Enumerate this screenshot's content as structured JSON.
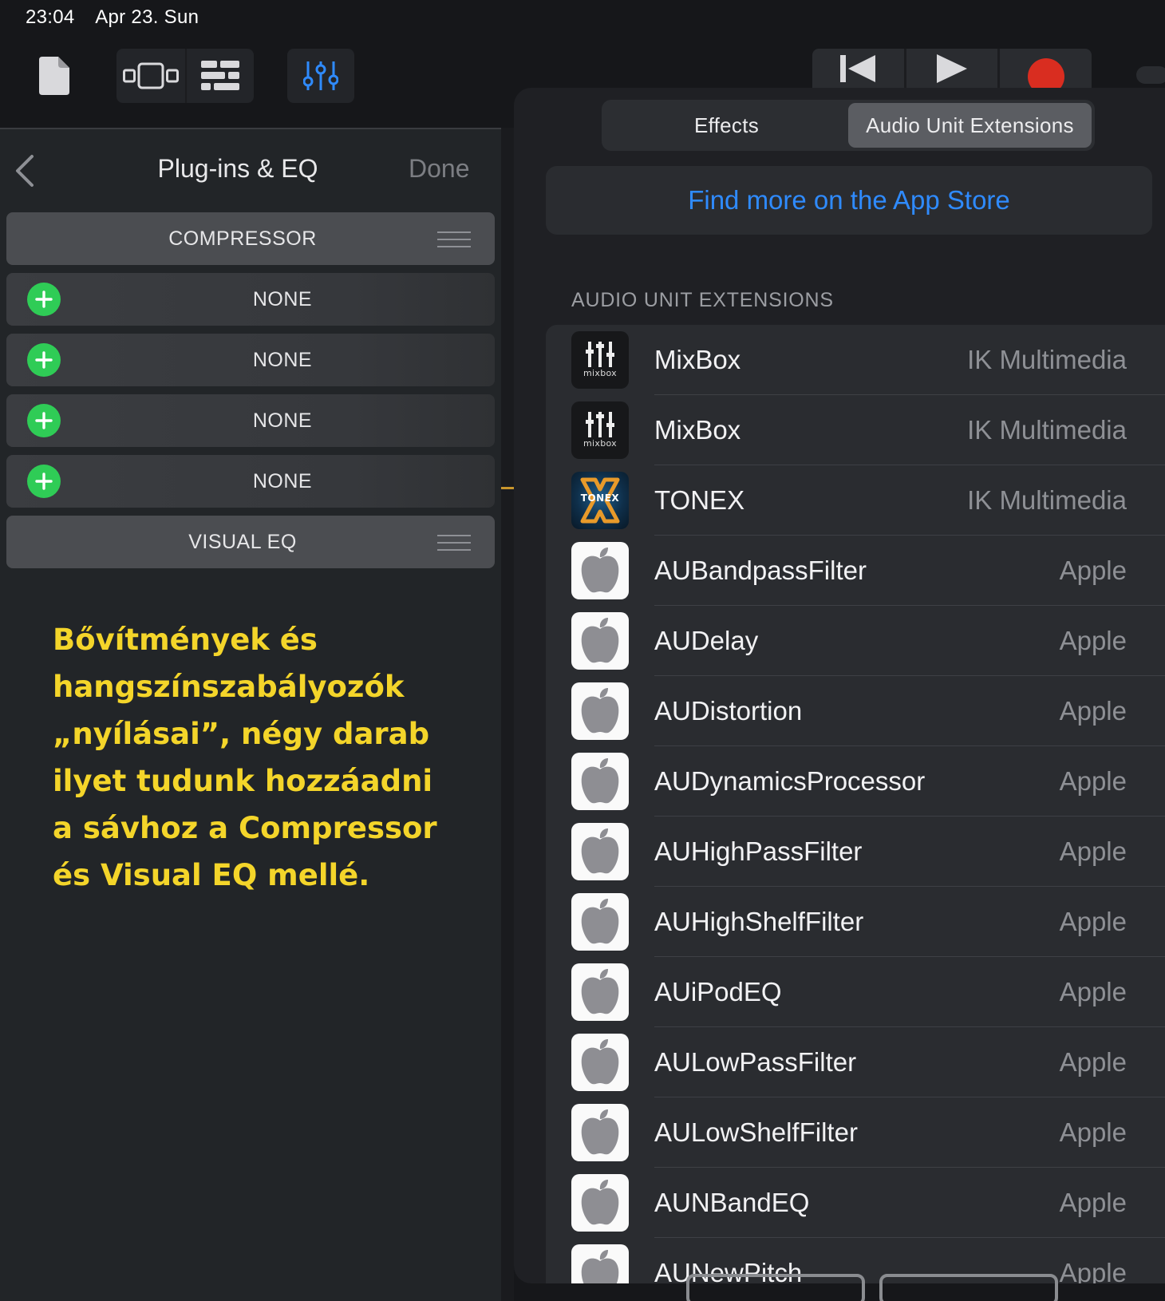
{
  "status_bar": {
    "time": "23:04",
    "date": "Apr 23. Sun"
  },
  "toolbar": {
    "icons": [
      "document-icon",
      "browser-view-icon",
      "tracks-view-icon",
      "mixer-icon",
      "rewind-icon",
      "play-icon",
      "record-icon"
    ],
    "accent_color": "#2f8bff",
    "record_color": "#d92d20"
  },
  "left_panel": {
    "back_label": "",
    "title": "Plug-ins & EQ",
    "done_label": "Done",
    "compressor_label": "COMPRESSOR",
    "slots": [
      {
        "label": "NONE"
      },
      {
        "label": "NONE"
      },
      {
        "label": "NONE"
      },
      {
        "label": "NONE"
      }
    ],
    "visual_eq_label": "VISUAL EQ",
    "add_color": "#2fcc56"
  },
  "annotation": {
    "lines": [
      "Bővítmények és",
      "hangszínszabályozók",
      "„nyílásai”, négy darab",
      "ilyet tudunk hozzáadni",
      "a sávhoz a Compressor",
      "és Visual EQ mellé."
    ],
    "color": "#f4d52a"
  },
  "popover": {
    "tabs": [
      {
        "label": "Effects",
        "active": false
      },
      {
        "label": "Audio Unit Extensions",
        "active": true
      }
    ],
    "app_store_link": "Find more on the App Store",
    "section_header": "AUDIO UNIT EXTENSIONS",
    "extensions": [
      {
        "name": "MixBox",
        "vendor": "IK Multimedia",
        "icon": "mixbox-icon"
      },
      {
        "name": "MixBox",
        "vendor": "IK Multimedia",
        "icon": "mixbox-icon"
      },
      {
        "name": "TONEX",
        "vendor": "IK Multimedia",
        "icon": "tonex-icon"
      },
      {
        "name": "AUBandpassFilter",
        "vendor": "Apple",
        "icon": "apple-icon"
      },
      {
        "name": "AUDelay",
        "vendor": "Apple",
        "icon": "apple-icon"
      },
      {
        "name": "AUDistortion",
        "vendor": "Apple",
        "icon": "apple-icon"
      },
      {
        "name": "AUDynamicsProcessor",
        "vendor": "Apple",
        "icon": "apple-icon"
      },
      {
        "name": "AUHighPassFilter",
        "vendor": "Apple",
        "icon": "apple-icon"
      },
      {
        "name": "AUHighShelfFilter",
        "vendor": "Apple",
        "icon": "apple-icon"
      },
      {
        "name": "AUiPodEQ",
        "vendor": "Apple",
        "icon": "apple-icon"
      },
      {
        "name": "AULowPassFilter",
        "vendor": "Apple",
        "icon": "apple-icon"
      },
      {
        "name": "AULowShelfFilter",
        "vendor": "Apple",
        "icon": "apple-icon"
      },
      {
        "name": "AUNBandEQ",
        "vendor": "Apple",
        "icon": "apple-icon"
      },
      {
        "name": "AUNewPitch",
        "vendor": "Apple",
        "icon": "apple-icon"
      }
    ],
    "mixbox_wordmark": "mixbox",
    "tonex_wordmark": "TONEX"
  }
}
